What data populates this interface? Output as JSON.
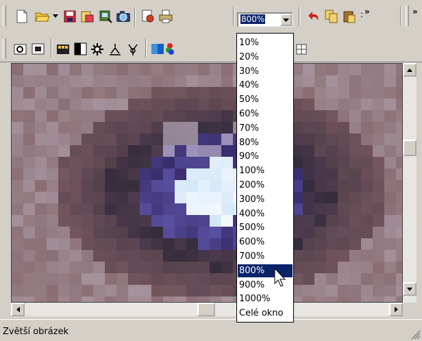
{
  "toolbar": {
    "zoom_value": "800%",
    "overflow_glyph": "»"
  },
  "zoom_menu": {
    "options": [
      "10%",
      "20%",
      "30%",
      "40%",
      "50%",
      "60%",
      "70%",
      "80%",
      "90%",
      "100%",
      "200%",
      "300%",
      "400%",
      "500%",
      "600%",
      "700%",
      "800%",
      "900%",
      "1000%",
      "Celé okno"
    ],
    "selected": "800%"
  },
  "status": {
    "text": "Zvětší obrázek"
  },
  "icons": {
    "toolbar1": [
      "new-document-icon",
      "open-folder-icon",
      "save-icon",
      "save-as-icon",
      "scan-icon",
      "camera-icon",
      "print-preview-icon",
      "print-icon",
      "undo-icon",
      "copy-icon",
      "paste-icon"
    ],
    "toolbar2": [
      "rotate-icon",
      "fit-icon",
      "filmstrip-icon",
      "contrast-icon",
      "brightness-icon",
      "sharpen-icon",
      "effects-icon",
      "color-icon",
      "grid-icon"
    ]
  },
  "colors": {
    "chrome": "#d4d0c8",
    "selection": "#0a246a",
    "image_skin": "#8a6e74",
    "image_iris": "#3a2e6a",
    "image_highlight": "#f4f8ff"
  }
}
